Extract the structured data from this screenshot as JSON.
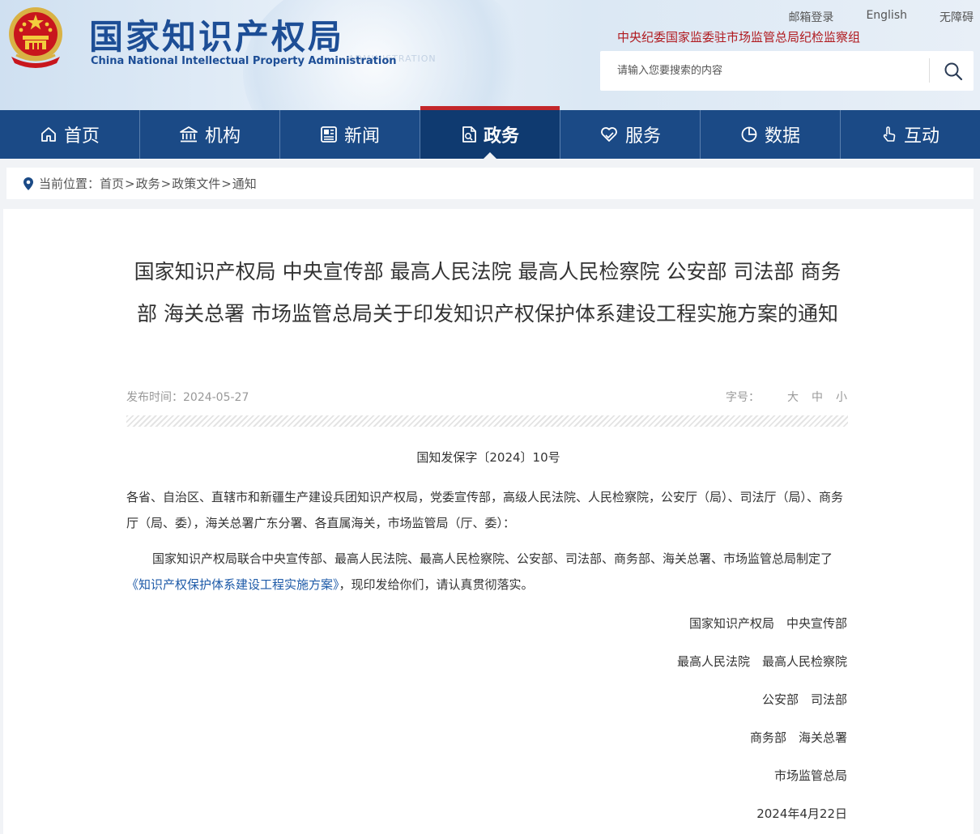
{
  "header": {
    "site_title": "国家知识产权局",
    "site_subtitle": "China National Intellectual Property Administration",
    "links": [
      "邮箱登录",
      "English",
      "无障碍"
    ],
    "discipline": "中央纪委国家监委驻市场监管总局纪检监察组",
    "search": {
      "placeholder": "请输入您要搜索的内容"
    }
  },
  "nav": {
    "items": [
      {
        "label": "首页",
        "icon": "home-icon"
      },
      {
        "label": "机构",
        "icon": "building-icon"
      },
      {
        "label": "新闻",
        "icon": "newspaper-icon"
      },
      {
        "label": "政务",
        "icon": "document-icon",
        "active": true
      },
      {
        "label": "服务",
        "icon": "heart-hand-icon"
      },
      {
        "label": "数据",
        "icon": "pie-chart-icon"
      },
      {
        "label": "互动",
        "icon": "pointer-hand-icon"
      }
    ]
  },
  "breadcrumb": {
    "prefix": "当前位置：",
    "items": [
      "首页",
      "政务",
      "政策文件",
      "通知"
    ],
    "separator": ">"
  },
  "article": {
    "title": "国家知识产权局 中央宣传部 最高人民法院 最高人民检察院 公安部 司法部 商务部 海关总署 市场监管总局关于印发知识产权保护体系建设工程实施方案的通知",
    "date_label": "发布时间：",
    "date": "2024-05-27",
    "font_label": "字号：",
    "font_options": [
      "大",
      "中",
      "小"
    ],
    "doc_number": "国知发保字〔2024〕10号",
    "recipients": "各省、自治区、直辖市和新疆生产建设兵团知识产权局，党委宣传部，高级人民法院、人民检察院，公安厅（局）、司法厅（局）、商务厅（局、委），海关总署广东分署、各直属海关，市场监管局（厅、委）：",
    "body_prefix": "国家知识产权局联合中央宣传部、最高人民法院、最高人民检察院、公安部、司法部、商务部、海关总署、市场监管总局制定了",
    "body_link": "《知识产权保护体系建设工程实施方案》",
    "body_suffix": "，现印发给你们，请认真贯彻落实。",
    "signatures": [
      "国家知识产权局　中央宣传部",
      "最高人民法院　最高人民检察院",
      "公安部　司法部",
      "商务部　海关总署",
      "市场监管总局",
      "2024年4月22日"
    ]
  },
  "colors": {
    "nav_bg": "#1b4a86",
    "nav_active": "#0f3a70",
    "nav_active_top": "#c3272b",
    "brand_blue": "#1d4e96",
    "discipline_red": "#b0191e",
    "link_blue": "#1d5aa8"
  }
}
